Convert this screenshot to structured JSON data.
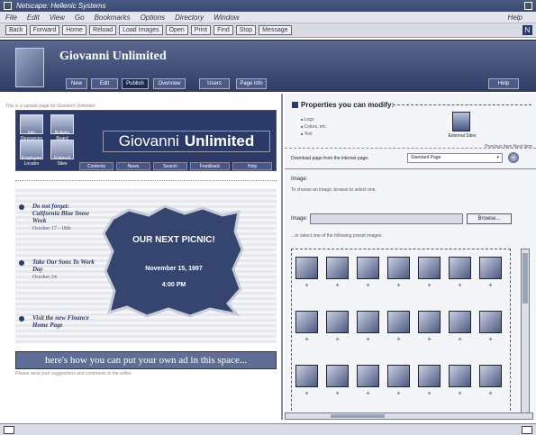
{
  "window": {
    "title": "Netscape: Hellenic Systems"
  },
  "menubar": {
    "items": [
      "File",
      "Edit",
      "View",
      "Go",
      "Bookmarks",
      "Options",
      "Directory",
      "Window"
    ],
    "help": "Help"
  },
  "toolbar": {
    "buttons": [
      "Back",
      "Forward",
      "Home",
      "Reload",
      "Load Images",
      "Open",
      "Print",
      "Find",
      "Stop",
      "Message"
    ]
  },
  "header": {
    "site_title": "Giovanni Unlimited",
    "nav": [
      "New",
      "Edit",
      "Publish",
      "Overview",
      "Users",
      "Page info"
    ],
    "active_nav": "Publish",
    "help": "Help"
  },
  "left": {
    "top_note": "This is a sample page for Giovanni Unlimited",
    "banner": {
      "name_part1": "Giovanni",
      "name_part2": "Unlimited",
      "icons": [
        "Info Resources",
        "Bulletin Board",
        "Employee Locator",
        "External Sites"
      ],
      "tabs": [
        "Contents",
        "News",
        "Search",
        "Feedback",
        "Help"
      ]
    },
    "news": [
      {
        "title": "Do not forget: California Blue Snow Week",
        "date": "October 17 - 18th"
      },
      {
        "title": "Take Our Sons To Work Day",
        "date": "October 24"
      },
      {
        "title": "Visit the new Finance Home Page",
        "date": ""
      }
    ],
    "picnic": {
      "heading": "OUR NEXT PICNIC!",
      "date": "November 15, 1997",
      "time": "4:00 PM"
    },
    "ad_bar": "here's how you can put your own ad in this space...",
    "ad_note": "Please send your suggestions and comments to the editor."
  },
  "right": {
    "props_title": "Properties you can modify:",
    "props_list": [
      "Logo",
      "Colors, etc.",
      "Text"
    ],
    "external_icon_label": "External Sites",
    "prev_next": "Previous item  Next item",
    "sub_label": "Download page from the internet page:",
    "sub_select": "Standard Page",
    "image_label": "Image:",
    "image_help": "To choose an image, browse to select one.",
    "image_row_label": "Image:",
    "browse_label": "Browse...",
    "choose_label": "...or select one of the following preset images:",
    "gallery_icons": [
      "monitor-icon",
      "disc-icon",
      "camera-icon",
      "bulb-icon",
      "folder-icon",
      "dollar-icon",
      "notepad-icon",
      "document-icon",
      "people-icon",
      "target-icon",
      "book-icon",
      "stamp-icon",
      "gear-icon",
      "phone-icon",
      "books-icon",
      "calendar-icon",
      "envelope-icon",
      "globe-icon",
      "pencil-icon",
      "lightbulb-icon",
      "cd-icon"
    ]
  },
  "colors": {
    "header_bg": "#2f3d66",
    "banner_bg": "#2b3a66",
    "ad_bar_bg": "#5f6e94",
    "tile_bg": "#4c5a82"
  }
}
